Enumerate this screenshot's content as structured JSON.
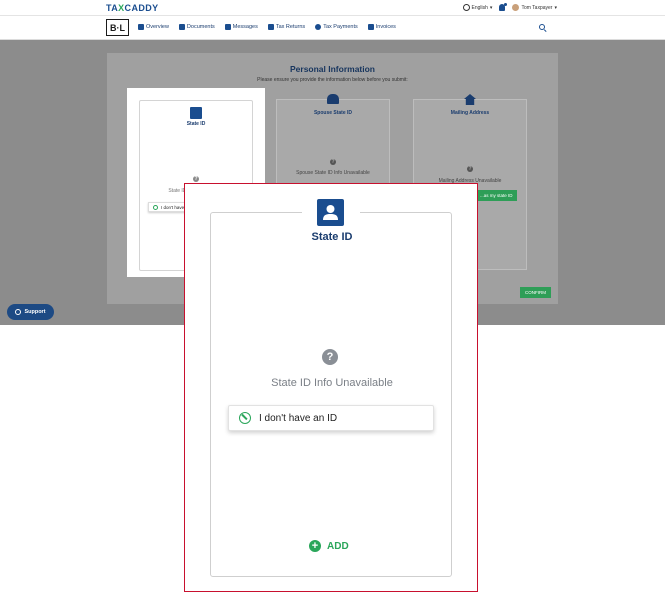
{
  "topbar": {
    "brand_pre": "TA",
    "brand_x": "X",
    "brand_post": "CADDY",
    "language": "English",
    "user_name": "Tom Taxpayer"
  },
  "nav": {
    "logo": "B·L",
    "items": [
      {
        "label": "Overview"
      },
      {
        "label": "Documents"
      },
      {
        "label": "Messages"
      },
      {
        "label": "Tax Returns"
      },
      {
        "label": "Tax Payments"
      },
      {
        "label": "Invoices"
      }
    ]
  },
  "panel": {
    "title": "Personal Information",
    "subtitle": "Please ensure you provide the information below before you submit:",
    "cards": [
      {
        "title": "State ID",
        "unavailable": "State ID Info Unavailable",
        "button": "I don't have an ID"
      },
      {
        "title": "Spouse State ID",
        "unavailable": "Spouse State ID Info Unavailable"
      },
      {
        "title": "Mailing Address",
        "unavailable": "Mailing Address Unavailable",
        "button": "...as my state ID"
      }
    ],
    "confirm_label": "CONFIRM"
  },
  "support": {
    "label": "Support"
  },
  "zoom": {
    "title": "State ID",
    "unavailable": "State ID Info Unavailable",
    "no_id_label": "I don't have an ID",
    "add_label": "ADD"
  },
  "colors": {
    "brand": "#1a4d8f",
    "accent_green": "#2aa65a",
    "highlight_border": "#c8102e"
  }
}
